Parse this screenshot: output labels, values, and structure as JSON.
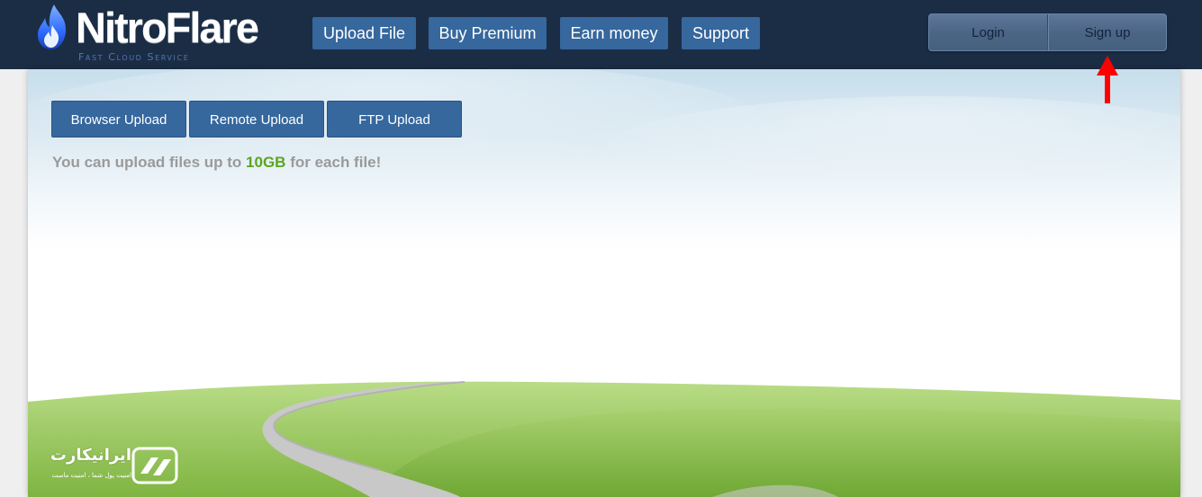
{
  "header": {
    "logo": {
      "name": "NitroFlare",
      "tagline": "Fast Cloud Service"
    },
    "nav": [
      {
        "label": "Upload File"
      },
      {
        "label": "Buy Premium"
      },
      {
        "label": "Earn money"
      },
      {
        "label": "Support"
      }
    ],
    "auth": {
      "login_label": "Login",
      "signup_label": "Sign up"
    }
  },
  "upload": {
    "tabs": [
      {
        "label": "Browser Upload"
      },
      {
        "label": "Remote Upload"
      },
      {
        "label": "FTP Upload"
      }
    ],
    "info_prefix": "You can upload files up to",
    "info_limit": "10GB",
    "info_suffix": "for each file!"
  },
  "watermark": {
    "title": "ایرانیکارت",
    "subtitle": "امنیت پول شما ، امنیت ماست"
  },
  "annotation": {
    "color": "#ff0000",
    "icon": "red-arrow-up-icon"
  },
  "colors": {
    "header_bg": "#1b2d45",
    "button_bg": "#36679d",
    "limit_highlight": "#5aa61e",
    "info_text": "#9a9a9a"
  }
}
